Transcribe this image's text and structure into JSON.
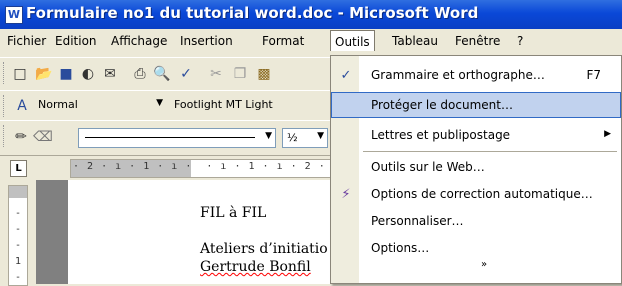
{
  "window": {
    "title": "Formulaire no1 du tutorial word.doc - Microsoft Word",
    "app_icon_letter": "W"
  },
  "menubar": {
    "items": [
      "Fichier",
      "Edition",
      "Affichage",
      "Insertion",
      "Format",
      "Outils",
      "Tableau",
      "Fenêtre",
      "?"
    ],
    "active": "Outils"
  },
  "toolbar_format": {
    "style": "Normal",
    "font": "Footlight MT Light"
  },
  "toolbar_draw": {
    "fraction": "½"
  },
  "ruler": {
    "marks": "· 2 · ı · 1 · ı ·  · ı · 1 · ı · 2 · ı"
  },
  "vruler": {
    "marks": [
      "-",
      "-",
      "-",
      "1",
      "-"
    ]
  },
  "document": {
    "lines": [
      "FIL à FIL",
      "Ateliers d’initiatio",
      "Gertrude Bonfil"
    ]
  },
  "outils_menu": {
    "items": [
      {
        "label": "Grammaire et orthographe…",
        "shortcut": "F7",
        "icon": "spellcheck-icon"
      },
      {
        "label": "Protéger le document…",
        "highlighted": true
      },
      {
        "label": "Lettres et publipostage",
        "submenu": true
      },
      {
        "label": "Outils sur le Web…"
      },
      {
        "label": "Options de correction automatique…",
        "icon": "autocorrect-icon"
      },
      {
        "label": "Personnaliser…"
      },
      {
        "label": "Options…"
      }
    ],
    "expand_glyph": "»"
  },
  "colors": {
    "title_blue": "#0a48d8",
    "menu_highlight": "#c1d2ee",
    "menu_highlight_border": "#316ac5"
  }
}
